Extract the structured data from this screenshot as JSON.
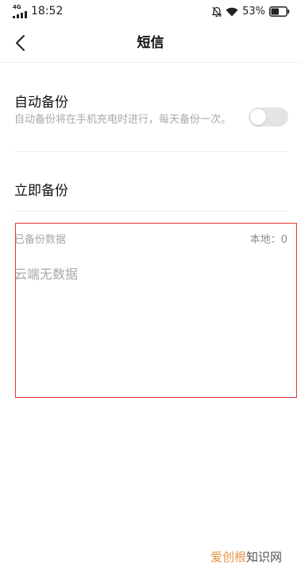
{
  "status_bar": {
    "network": "4G",
    "time": "18:52",
    "battery_percent": "53%",
    "battery_level": 0.53,
    "icons": [
      "mute-icon",
      "wifi-icon",
      "battery-icon"
    ]
  },
  "header": {
    "back_icon": "chevron-left-icon",
    "title": "短信"
  },
  "auto_backup": {
    "title": "自动备份",
    "description": "自动备份将在手机充电时进行，每天备份一次。",
    "enabled": false
  },
  "backup_now": {
    "label": "立即备份"
  },
  "backed_up": {
    "header": "已备份数据",
    "local_count": "本地：0",
    "cloud_empty": "云端无数据"
  },
  "watermark": {
    "brand": "爱创根",
    "suffix": "知识网"
  },
  "colors": {
    "highlight_border": "#e53935",
    "secondary_text": "#a8a8a8",
    "toggle_off": "#e4e4e4",
    "watermark_brand": "#e0822a"
  }
}
